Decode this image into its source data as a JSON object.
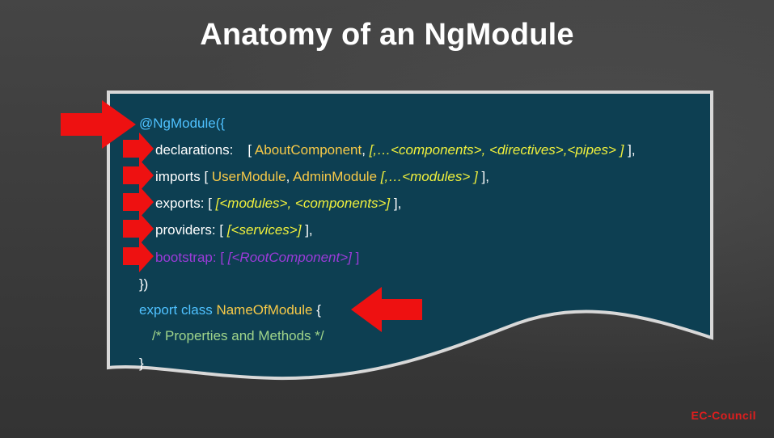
{
  "slide": {
    "title": "Anatomy of an NgModule",
    "logo": "EC-Council"
  },
  "code": {
    "decorator": "@NgModule({",
    "declarations_key": "declarations:",
    "declarations_open": "[ ",
    "declarations_component": "AboutComponent",
    "declarations_sep": ", ",
    "declarations_generic": "[,…<components>, <directives>,<pipes> ]",
    "declarations_close": " ],",
    "imports_key": "imports [ ",
    "imports_user": "UserModule",
    "imports_sep": ", ",
    "imports_admin": "AdminModule",
    "imports_generic": " [,…<modules> ]",
    "imports_close": " ],",
    "exports_key": "exports: [ ",
    "exports_generic": "[<modules>, <components>]",
    "exports_close": " ],",
    "providers_key": "providers:  [ ",
    "providers_generic": "[<services>]",
    "providers_close": " ],",
    "bootstrap_key": "bootstrap:  [ ",
    "bootstrap_generic": "[<RootComponent>]",
    "bootstrap_close": " ]",
    "decorator_close": "})",
    "export_kw": "export class ",
    "class_name": "NameOfModule",
    "class_open": "  {",
    "comment": "/* Properties and Methods */",
    "class_close": "}"
  },
  "colors": {
    "card_bg": "#0d3f52",
    "card_border": "#d8d8d8",
    "arrow": "#ee1111",
    "keyword": "#4fc1ff",
    "class_name": "#f7c948",
    "generic": "#f0f03c",
    "bootstrap": "#9b3bd8",
    "comment": "#9fd48a"
  }
}
